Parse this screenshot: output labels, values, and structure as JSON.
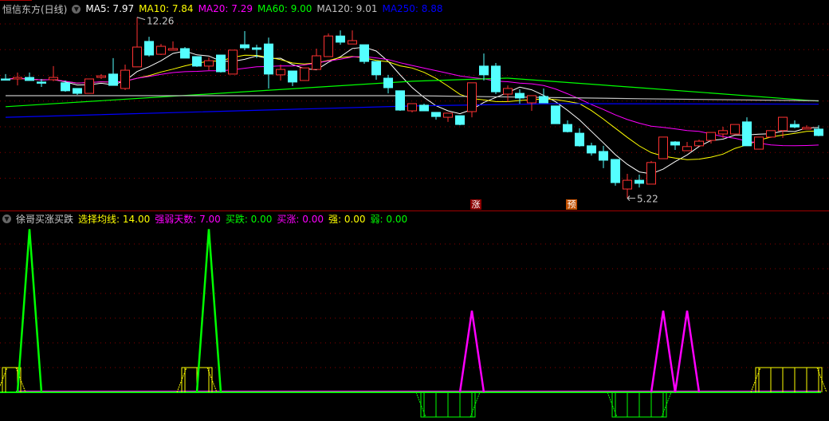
{
  "main_header": {
    "title": "恒信东方(日线)",
    "ma": [
      {
        "label": "MA5: 7.97",
        "color": "#ffffff"
      },
      {
        "label": "MA10: 7.84",
        "color": "#ffff00"
      },
      {
        "label": "MA20: 7.29",
        "color": "#ff00ff"
      },
      {
        "label": "MA60: 9.00",
        "color": "#00ff00"
      },
      {
        "label": "MA120: 9.01",
        "color": "#c0c0c0"
      },
      {
        "label": "MA250: 8.88",
        "color": "#0000ff"
      }
    ]
  },
  "indicator_header": {
    "title": "徐哥买涨买跌",
    "params": [
      {
        "label": "选择均线: 14.00",
        "color": "#ffff00"
      },
      {
        "label": "强弱天数: 7.00",
        "color": "#ff00ff"
      },
      {
        "label": "买跌: 0.00",
        "color": "#00ff00"
      },
      {
        "label": "买涨: 0.00",
        "color": "#ff00ff"
      },
      {
        "label": "强: 0.00",
        "color": "#ffff00"
      },
      {
        "label": "弱: 0.00",
        "color": "#00ff00"
      }
    ]
  },
  "markers": {
    "rise": "涨",
    "predict": "预"
  },
  "chart_data": {
    "type": "candlestick",
    "high_label": "12.26",
    "low_label": "5.22",
    "ylim": [
      5,
      12.3
    ],
    "colors": {
      "up": "#ff3232",
      "down": "#54ffff"
    },
    "ohlc": [
      [
        9.86,
        10.05,
        9.8,
        9.85
      ],
      [
        9.86,
        10.11,
        9.61,
        9.92
      ],
      [
        9.92,
        10.11,
        9.8,
        9.8
      ],
      [
        9.74,
        9.86,
        9.55,
        9.71
      ],
      [
        9.83,
        10.36,
        9.77,
        9.92
      ],
      [
        9.71,
        9.8,
        9.36,
        9.4
      ],
      [
        9.49,
        9.49,
        9.24,
        9.3
      ],
      [
        9.3,
        9.86,
        9.3,
        9.86
      ],
      [
        9.92,
        10.05,
        9.86,
        9.98
      ],
      [
        10.05,
        10.67,
        9.61,
        9.61
      ],
      [
        9.49,
        10.42,
        9.43,
        10.2
      ],
      [
        10.33,
        12.26,
        10.33,
        11.1
      ],
      [
        11.32,
        11.5,
        10.73,
        10.79
      ],
      [
        10.82,
        11.22,
        10.79,
        11.13
      ],
      [
        10.98,
        11.32,
        10.98,
        11.04
      ],
      [
        11.04,
        11.1,
        10.67,
        10.67
      ],
      [
        10.73,
        10.73,
        10.33,
        10.36
      ],
      [
        10.36,
        10.7,
        10.2,
        10.57
      ],
      [
        10.79,
        10.79,
        10.11,
        10.14
      ],
      [
        10.05,
        10.98,
        10.05,
        10.98
      ],
      [
        11.19,
        11.72,
        10.98,
        11.07
      ],
      [
        11.07,
        11.19,
        10.67,
        11.01
      ],
      [
        11.22,
        11.47,
        9.49,
        10.05
      ],
      [
        10.02,
        10.42,
        9.8,
        10.23
      ],
      [
        10.17,
        10.17,
        9.58,
        9.74
      ],
      [
        9.8,
        10.29,
        9.8,
        10.29
      ],
      [
        10.23,
        11.04,
        10.23,
        10.76
      ],
      [
        10.73,
        11.63,
        10.73,
        11.53
      ],
      [
        11.53,
        11.75,
        11.19,
        11.29
      ],
      [
        11.22,
        11.75,
        11.22,
        11.35
      ],
      [
        11.19,
        11.19,
        10.45,
        10.54
      ],
      [
        10.54,
        10.54,
        9.83,
        10.02
      ],
      [
        9.89,
        10.02,
        9.3,
        9.52
      ],
      [
        9.4,
        9.4,
        8.62,
        8.65
      ],
      [
        8.62,
        8.9,
        8.56,
        8.9
      ],
      [
        8.84,
        8.9,
        8.62,
        8.62
      ],
      [
        8.56,
        8.56,
        8.28,
        8.4
      ],
      [
        8.37,
        8.53,
        8.19,
        8.53
      ],
      [
        8.43,
        8.43,
        8.06,
        8.09
      ],
      [
        8.59,
        9.71,
        8.37,
        9.71
      ],
      [
        10.36,
        10.85,
        9.8,
        10.02
      ],
      [
        10.36,
        10.48,
        9.27,
        9.36
      ],
      [
        9.27,
        9.61,
        8.96,
        9.49
      ],
      [
        9.3,
        9.46,
        8.9,
        9.12
      ],
      [
        8.93,
        9.21,
        8.62,
        9.21
      ],
      [
        9.18,
        9.49,
        8.93,
        8.93
      ],
      [
        8.81,
        8.81,
        8.12,
        8.12
      ],
      [
        8.09,
        8.25,
        7.78,
        7.81
      ],
      [
        7.75,
        7.94,
        7.23,
        7.26
      ],
      [
        7.26,
        7.38,
        6.88,
        6.98
      ],
      [
        7.04,
        7.26,
        6.39,
        6.7
      ],
      [
        6.73,
        6.73,
        5.71,
        5.83
      ],
      [
        5.58,
        6.17,
        5.22,
        5.92
      ],
      [
        5.92,
        6.14,
        5.64,
        5.8
      ],
      [
        5.77,
        6.67,
        5.77,
        6.61
      ],
      [
        6.76,
        7.6,
        6.76,
        7.6
      ],
      [
        7.41,
        7.44,
        7.1,
        7.29
      ],
      [
        7.07,
        7.41,
        7.07,
        7.23
      ],
      [
        7.26,
        7.5,
        7.26,
        7.44
      ],
      [
        7.47,
        7.78,
        7.35,
        7.78
      ],
      [
        7.72,
        8.0,
        7.57,
        7.85
      ],
      [
        7.72,
        8.09,
        7.72,
        8.09
      ],
      [
        8.19,
        8.37,
        7.26,
        7.26
      ],
      [
        7.13,
        7.6,
        7.13,
        7.6
      ],
      [
        7.6,
        7.85,
        7.57,
        7.85
      ],
      [
        7.85,
        8.37,
        7.57,
        8.37
      ],
      [
        8.09,
        8.25,
        7.94,
        7.99
      ],
      [
        7.91,
        8.06,
        7.91,
        7.97
      ],
      [
        7.91,
        8.06,
        7.63,
        7.66
      ]
    ],
    "high_index": 11,
    "low_index": 52,
    "rise_marker_index": 39,
    "predict_marker_index": 47,
    "ma_computed": [
      {
        "period": 5,
        "color": "#ffffff"
      },
      {
        "period": 10,
        "color": "#ffff00"
      },
      {
        "period": 20,
        "color": "#ff00ff"
      }
    ],
    "ma_anchors": [
      {
        "name": "MA60",
        "color": "#00ff00",
        "points": [
          [
            0,
            8.78
          ],
          [
            34,
            9.77
          ],
          [
            42,
            9.89
          ],
          [
            53,
            9.52
          ],
          [
            68,
            9.0
          ]
        ]
      },
      {
        "name": "MA120",
        "color": "#c0c0c0",
        "points": [
          [
            0,
            9.21
          ],
          [
            34,
            9.21
          ],
          [
            53,
            9.09
          ],
          [
            68,
            9.01
          ]
        ]
      },
      {
        "name": "MA250",
        "color": "#0000ff",
        "points": [
          [
            0,
            8.37
          ],
          [
            34,
            8.81
          ],
          [
            46,
            8.9
          ],
          [
            68,
            8.88
          ]
        ]
      }
    ],
    "indicator": {
      "buy_fall_spikes": {
        "color": "#00ff00",
        "value": 6.6,
        "indices": [
          2,
          17
        ]
      },
      "buy_rise_spikes": {
        "color": "#ff00ff",
        "value": 3.3,
        "indices": [
          39,
          55,
          57
        ]
      },
      "strong_runs": {
        "color": "#ffff00",
        "value": 1,
        "runs": [
          [
            0,
            1
          ],
          [
            15,
            17
          ],
          [
            63,
            68
          ]
        ]
      },
      "weak_runs": {
        "color": "#00ff00",
        "value": -1,
        "runs": [
          [
            35,
            39
          ],
          [
            51,
            55
          ]
        ]
      }
    }
  }
}
